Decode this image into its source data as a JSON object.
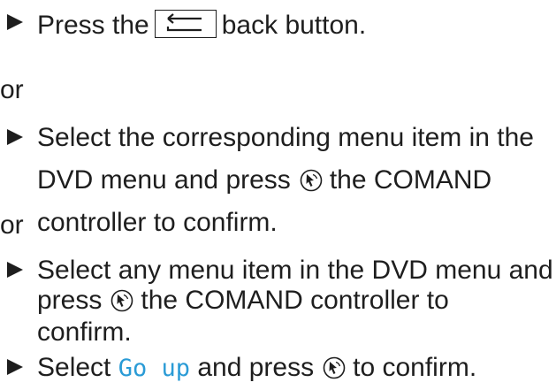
{
  "instructions": {
    "item1": {
      "before": "Press the",
      "icon": "back-button-icon",
      "after": "back button."
    },
    "or1": "or",
    "item2": {
      "line1": "Select the corresponding menu item in the",
      "line2_before": "DVD menu and press",
      "line2_icon": "comand-controller-press-icon",
      "line2_after": "the COMAND",
      "line3": "controller to confirm."
    },
    "or2": "or",
    "item3": {
      "line1": "Select any menu item in the DVD menu and",
      "line2_before": "press",
      "line2_icon": "comand-controller-press-icon",
      "line2_after": "the COMAND controller to",
      "line3": "confirm."
    },
    "item4": {
      "before": "Select",
      "highlight": "Go up",
      "middle": "and press",
      "icon": "comand-controller-press-icon",
      "after": "to confirm."
    }
  },
  "colors": {
    "text": "#1e1e1e",
    "highlight": "#2a9bd6"
  }
}
